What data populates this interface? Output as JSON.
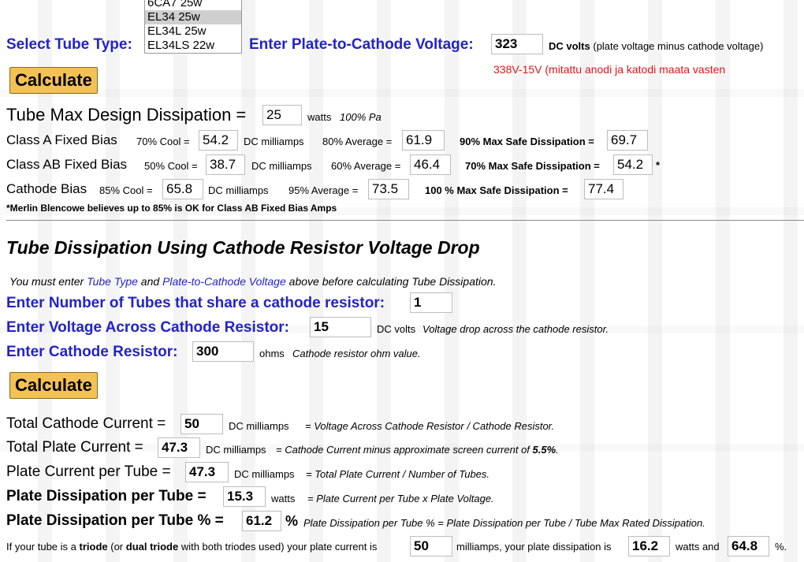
{
  "tube_select": {
    "label": "Select Tube Type:",
    "options": [
      "6CA7 25w",
      "EL34 25w",
      "EL34L 25w",
      "EL34LS 22w"
    ],
    "selected": "EL34 25w"
  },
  "plate_voltage": {
    "label": "Enter Plate-to-Cathode Voltage:",
    "value": "323",
    "unit": "DC volts",
    "note": "(plate voltage minus cathode voltage)",
    "annotation": "338V-15V (mitattu anodi ja katodi maata vasten"
  },
  "calculate_label": "Calculate",
  "max_dissipation": {
    "label": "Tube Max Design Dissipation =",
    "value": "25",
    "unit": "watts",
    "note": "100% Pa"
  },
  "class_a": {
    "label": "Class A Fixed Bias",
    "cool_label": "70% Cool =",
    "cool_value": "54.2",
    "unit": "DC milliamps",
    "avg_label": "80% Average =",
    "avg_value": "61.9",
    "max_label": "90% Max Safe Dissipation =",
    "max_value": "69.7"
  },
  "class_ab": {
    "label": "Class AB Fixed Bias",
    "cool_label": "50% Cool =",
    "cool_value": "38.7",
    "unit": "DC milliamps",
    "avg_label": "60% Average =",
    "avg_value": "46.4",
    "max_label": "70% Max Safe Dissipation =",
    "max_value": "54.2",
    "star": "*"
  },
  "cathode_bias": {
    "label": "Cathode Bias",
    "cool_label": "85% Cool =",
    "cool_value": "65.8",
    "unit": "DC milliamps",
    "avg_label": "95% Average =",
    "avg_value": "73.5",
    "max_label": "100 % Max Safe Dissipation =",
    "max_value": "77.4"
  },
  "footnote": "*Merlin Blencowe believes up to 85% is OK for Class AB Fixed Bias Amps",
  "section2": {
    "title": "Tube Dissipation Using Cathode Resistor Voltage Drop",
    "intro_pre": "You must enter ",
    "intro_link1": "Tube Type",
    "intro_mid": " and ",
    "intro_link2": "Plate-to-Cathode Voltage",
    "intro_post": " above before calculating Tube Dissipation.",
    "num_tubes": {
      "label": "Enter Number of Tubes that share a cathode resistor:",
      "value": "1"
    },
    "voltage": {
      "label": "Enter Voltage Across Cathode Resistor:",
      "value": "15",
      "unit": "DC volts",
      "note": "Voltage drop across the cathode resistor."
    },
    "resistor": {
      "label": "Enter Cathode Resistor:",
      "value": "300",
      "unit": "ohms",
      "note": "Cathode resistor ohm value."
    }
  },
  "results": {
    "total_cathode": {
      "label": "Total Cathode Current =",
      "value": "50",
      "unit": "DC milliamps",
      "note": "= Voltage Across Cathode Resistor / Cathode Resistor."
    },
    "total_plate": {
      "label": "Total Plate Current =",
      "value": "47.3",
      "unit": "DC milliamps",
      "note_pre": "= Cathode Current minus approximate screen current of ",
      "note_bold": "5.5%",
      "note_post": "."
    },
    "plate_per_tube": {
      "label": "Plate Current per Tube =",
      "value": "47.3",
      "unit": "DC milliamps",
      "note": "= Total Plate Current / Number of Tubes."
    },
    "dissipation": {
      "label": "Plate Dissipation per Tube =",
      "value": "15.3",
      "unit": "watts",
      "note": "= Plate Current per Tube x Plate Voltage."
    },
    "dissipation_pct": {
      "label": "Plate Dissipation per Tube % =",
      "value": "61.2",
      "unit": "%",
      "note": "Plate Dissipation per Tube % = Plate Dissipation per Tube / Tube Max Rated Dissipation."
    }
  },
  "triode": {
    "pre": "If your tube is a ",
    "b1": "triode",
    "mid1": " (or ",
    "b2": "dual triode",
    "mid2": " with both triodes used) your plate current is",
    "current": "50",
    "mid3": "milliamps, your plate dissipation is",
    "diss": "16.2",
    "mid4": "watts and",
    "pct": "64.8",
    "end": "%."
  }
}
